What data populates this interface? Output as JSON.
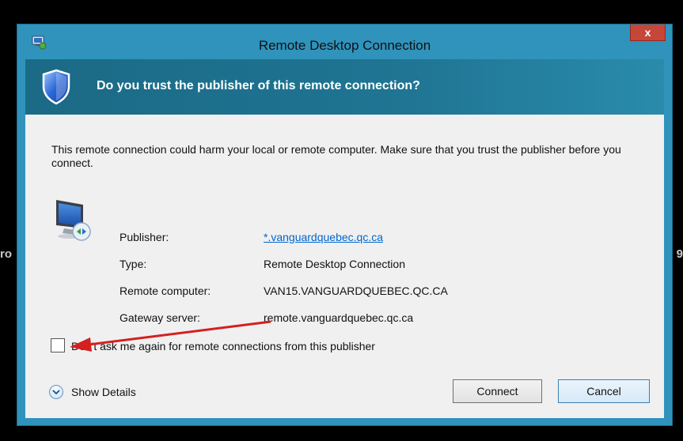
{
  "background_edge": {
    "left_text": "ro",
    "right_text": "9"
  },
  "window": {
    "title": "Remote Desktop Connection",
    "app_icon": "remote-desktop-icon",
    "close_label": "x"
  },
  "header": {
    "icon": "shield-icon",
    "question": "Do you trust the publisher of this remote connection?"
  },
  "warning_text": "This remote connection could harm your local or remote computer. Make sure that you trust the publisher before you connect.",
  "details": [
    {
      "label": "Publisher:",
      "value": "*.vanguardquebec.qc.ca"
    },
    {
      "label": "Type:",
      "value": "Remote Desktop Connection"
    },
    {
      "label": "Remote computer:",
      "value": "VAN15.VANGUARDQUEBEC.QC.CA"
    },
    {
      "label": "Gateway server:",
      "value": "remote.vanguardquebec.qc.ca"
    }
  ],
  "checkbox": {
    "label": "Don't ask me again for remote connections from this publisher",
    "checked": false
  },
  "show_details_label": "Show Details",
  "buttons": {
    "connect": "Connect",
    "cancel": "Cancel"
  },
  "colors": {
    "header_band": "#1b6a86",
    "window_frame": "#2f93bc",
    "link": "#0066cc",
    "annotation_arrow": "#d42020"
  }
}
